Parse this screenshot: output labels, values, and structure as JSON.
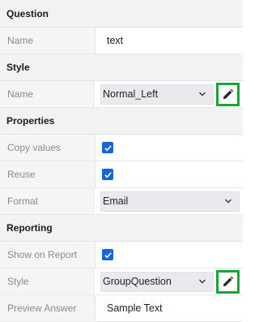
{
  "sections": {
    "question": {
      "title": "Question",
      "name_label": "Name",
      "name_value": "text"
    },
    "style": {
      "title": "Style",
      "name_label": "Name",
      "name_value": "Normal_Left"
    },
    "properties": {
      "title": "Properties",
      "copy_values_label": "Copy values",
      "copy_values_checked": true,
      "reuse_label": "Reuse",
      "reuse_checked": true,
      "format_label": "Format",
      "format_value": "Email"
    },
    "reporting": {
      "title": "Reporting",
      "show_on_report_label": "Show on Report",
      "show_on_report_checked": true,
      "style_label": "Style",
      "style_value": "GroupQuestion",
      "preview_answer_label": "Preview Answer",
      "preview_answer_value": "Sample Text"
    }
  },
  "icons": {
    "edit": "pencil-icon",
    "dropdown": "chevron-down-icon",
    "check": "check-icon"
  },
  "colors": {
    "edit_border": "#1aa33a",
    "checkbox": "#1565d8"
  }
}
